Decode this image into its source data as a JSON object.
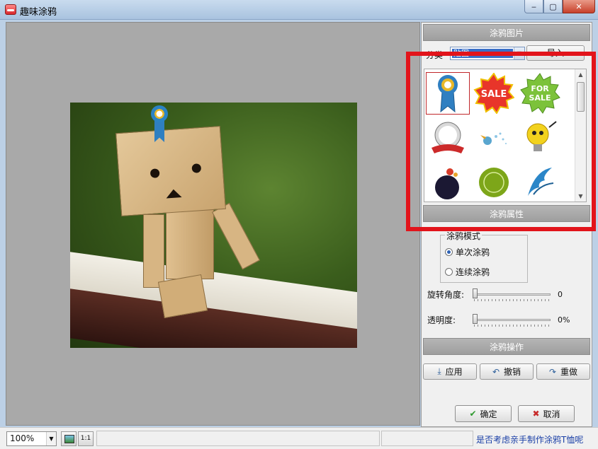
{
  "window": {
    "title": "趣味涂鸦",
    "minimize": "‒",
    "restore": "▢",
    "close": "✕"
  },
  "panel": {
    "gallery_header": "涂鸦图片",
    "category_label": "分类",
    "category_value": "贴图",
    "import_label": "导入",
    "properties_header": "涂鸦属性",
    "mode": {
      "legend": "涂鸦模式",
      "options": [
        {
          "label": "单次涂鸦",
          "selected": true
        },
        {
          "label": "连续涂鸦",
          "selected": false
        }
      ]
    },
    "rotation": {
      "label": "旋转角度:",
      "value": "0"
    },
    "opacity": {
      "label": "透明度:",
      "value": "0%"
    },
    "operations_header": "涂鸦操作",
    "buttons": {
      "apply": "应用",
      "undo": "撤销",
      "redo": "重做",
      "ok": "确定",
      "cancel": "取消"
    },
    "thumbnails": [
      "ribbon-badge",
      "sale-star-red",
      "for-sale-star-green",
      "banner-ribbon",
      "bird-splash",
      "lightbulb-character",
      "ink-flower",
      "green-stamp",
      "blue-wing"
    ]
  },
  "thumb_text": {
    "sale": "SALE",
    "for_sale": "FOR\nSALE"
  },
  "status": {
    "zoom": "100%",
    "actual_size": "1:1",
    "hint": "是否考虑亲手制作涂鸦T恤呢"
  },
  "colors": {
    "highlight": "#e2141b",
    "section_header": "#a6a6a6",
    "canvas": "#a9a9a9"
  }
}
